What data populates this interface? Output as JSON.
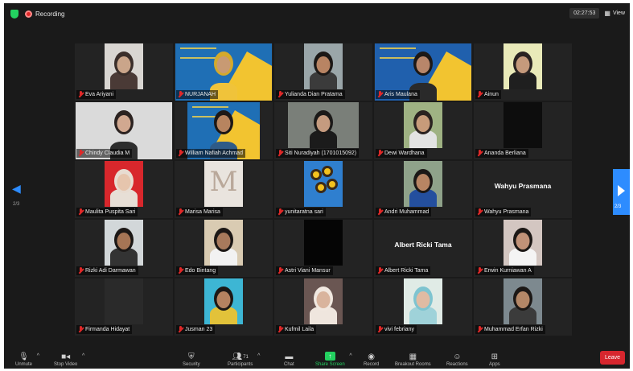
{
  "recording": {
    "label": "Recording"
  },
  "timer": "02:27:53",
  "view_label": "View",
  "pagination": {
    "left": "2/3",
    "right": "2/3"
  },
  "participants": [
    {
      "name": "Eva Ariyani",
      "video": true,
      "kind": "person",
      "bg": "#d9d6d2",
      "skin": "#caa58a",
      "hair": "#3a2e2a",
      "shirt": "#4a3a36"
    },
    {
      "name": "NURJANAH",
      "video": true,
      "kind": "slide",
      "bg": "#1f6fb5",
      "accent": "#f2c430",
      "skin": "#c89a73",
      "hair": "#d4a92c",
      "shirt": "#f0c33a"
    },
    {
      "name": "Yulianda Dian Pratama",
      "video": true,
      "kind": "person",
      "bg": "#9aa6a9",
      "skin": "#b88463",
      "hair": "#1c1816",
      "shirt": "#3b3b3b"
    },
    {
      "name": "Aris Maulana",
      "video": true,
      "kind": "slide",
      "bg": "#2060ad",
      "accent": "#f2c430",
      "skin": "#b8866a",
      "hair": "#1c1816",
      "shirt": "#2a2a2a"
    },
    {
      "name": "Ainun",
      "video": true,
      "kind": "person",
      "bg": "#e9eab9",
      "skin": "#c59a7c",
      "hair": "#2a2322",
      "shirt": "#1f1f1f"
    },
    {
      "name": "Chindy Claudia M",
      "video": true,
      "kind": "person-wide",
      "bg": "#dadada",
      "skin": "#d1a890",
      "hair": "#2b2220",
      "shirt": "#2d2d2d"
    },
    {
      "name": "William Nafiah Achmad",
      "video": true,
      "kind": "slide",
      "bg": "#1f6fb5",
      "accent": "#f2c430",
      "skin": "#b7845f",
      "hair": "#1c1816",
      "shirt": "#2f5b87"
    },
    {
      "name": "Siti Nuradiyah (1701015092)",
      "video": true,
      "kind": "person-mid",
      "bg": "#7a7f79",
      "skin": "#c59b7f",
      "hair": "#1b1918",
      "shirt": "#1b1b1b"
    },
    {
      "name": "Dewi Wardhana",
      "video": true,
      "kind": "person",
      "bg": "#9fb283",
      "skin": "#c79b7a",
      "hair": "#2a2220",
      "shirt": "#e3e3e3"
    },
    {
      "name": "Ananda Berliana",
      "video": true,
      "kind": "dark",
      "bg": "#0d0d0d"
    },
    {
      "name": "Maulita Puspita Sari",
      "video": true,
      "kind": "person",
      "bg": "#d8272c",
      "skin": "#e6c5ad",
      "hair": "#e8dcd1",
      "shirt": "#e7dfd6"
    },
    {
      "name": "Marisa Marisa",
      "video": true,
      "kind": "letter",
      "bg": "#e9e4de"
    },
    {
      "name": "yunitaratna sari",
      "video": true,
      "kind": "flowers",
      "bg": "#2f7fcf"
    },
    {
      "name": "Andri Muhammad",
      "video": true,
      "kind": "person",
      "bg": "#8fa28a",
      "skin": "#b88563",
      "hair": "#1c1816",
      "shirt": "#244f9e"
    },
    {
      "name": "Wahyu Prasmana",
      "video": false,
      "kind": "name"
    },
    {
      "name": "Rizki Adi Darmawan",
      "video": true,
      "kind": "person",
      "bg": "#d2d7d9",
      "skin": "#a67555",
      "hair": "#1c1816",
      "shirt": "#333333"
    },
    {
      "name": "Edo Bintang",
      "video": true,
      "kind": "person",
      "bg": "#d9cbb2",
      "skin": "#a87a5c",
      "hair": "#1c1816",
      "shirt": "#f2f2f2"
    },
    {
      "name": "Astri Viani Mansur",
      "video": true,
      "kind": "dark",
      "bg": "#050505"
    },
    {
      "name": "Albert Ricki Tama",
      "video": false,
      "kind": "name"
    },
    {
      "name": "Erwin Kurniawan A",
      "video": true,
      "kind": "person",
      "bg": "#d3c6c1",
      "skin": "#c19278",
      "hair": "#1c1816",
      "shirt": "#f4f4f4"
    },
    {
      "name": "Firmanda Hidayat",
      "video": true,
      "kind": "dark",
      "bg": "#2a2a2a"
    },
    {
      "name": "Jusman 23",
      "video": true,
      "kind": "person",
      "bg": "#3db6d4",
      "skin": "#b58260",
      "hair": "#1c1816",
      "shirt": "#e2c23a"
    },
    {
      "name": "Kufmil Laila",
      "video": true,
      "kind": "person",
      "bg": "#6a5652",
      "skin": "#d9b49d",
      "hair": "#f1e8e0",
      "shirt": "#efe6de"
    },
    {
      "name": "vivi febriany",
      "video": true,
      "kind": "person",
      "bg": "#e0ebe6",
      "skin": "#e0bba3",
      "hair": "#7ec4d0",
      "shirt": "#9fd2d9"
    },
    {
      "name": "Muhammad Erfan Rizki",
      "video": true,
      "kind": "person",
      "bg": "#7d898f",
      "skin": "#b48767",
      "hair": "#1c1816",
      "shirt": "#3b3b3b"
    }
  ],
  "toolbar": {
    "unmute": "Unmute",
    "stop_video": "Stop Video",
    "security": "Security",
    "participants": "Participants",
    "participants_count": "71",
    "chat": "Chat",
    "share_screen": "Share Screen",
    "record": "Record",
    "breakout_rooms": "Breakout Rooms",
    "reactions": "Reactions",
    "apps": "Apps",
    "leave": "Leave"
  }
}
